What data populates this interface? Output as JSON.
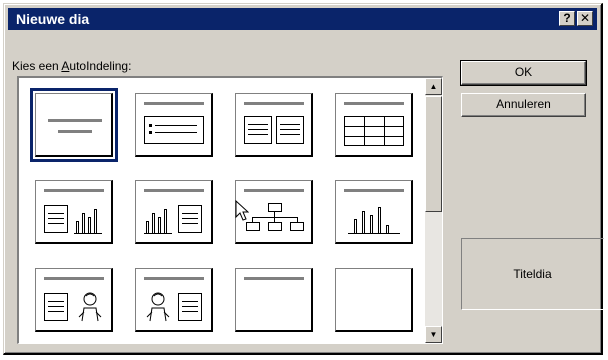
{
  "window": {
    "title": "Nieuwe dia",
    "help_label": "?",
    "close_label": "✕"
  },
  "prompt": {
    "before": "Kies een ",
    "accel": "A",
    "after": "utoIndeling:"
  },
  "buttons": {
    "ok": "OK",
    "cancel": "Annuleren"
  },
  "preview": {
    "label": "Titeldia"
  },
  "layouts": {
    "count": 12,
    "selected_index": 0,
    "items": [
      "title",
      "bulleted-list",
      "two-column-text",
      "table",
      "text-and-chart",
      "chart-and-text",
      "organization-chart",
      "chart",
      "text-and-clip-art",
      "clip-art-and-text",
      "title-only",
      "blank"
    ]
  },
  "scrollbar": {
    "up_glyph": "▲",
    "down_glyph": "▼"
  },
  "colors": {
    "titlebar": "#0a246a",
    "face": "#d4d0c8",
    "selection": "#0a246a"
  }
}
